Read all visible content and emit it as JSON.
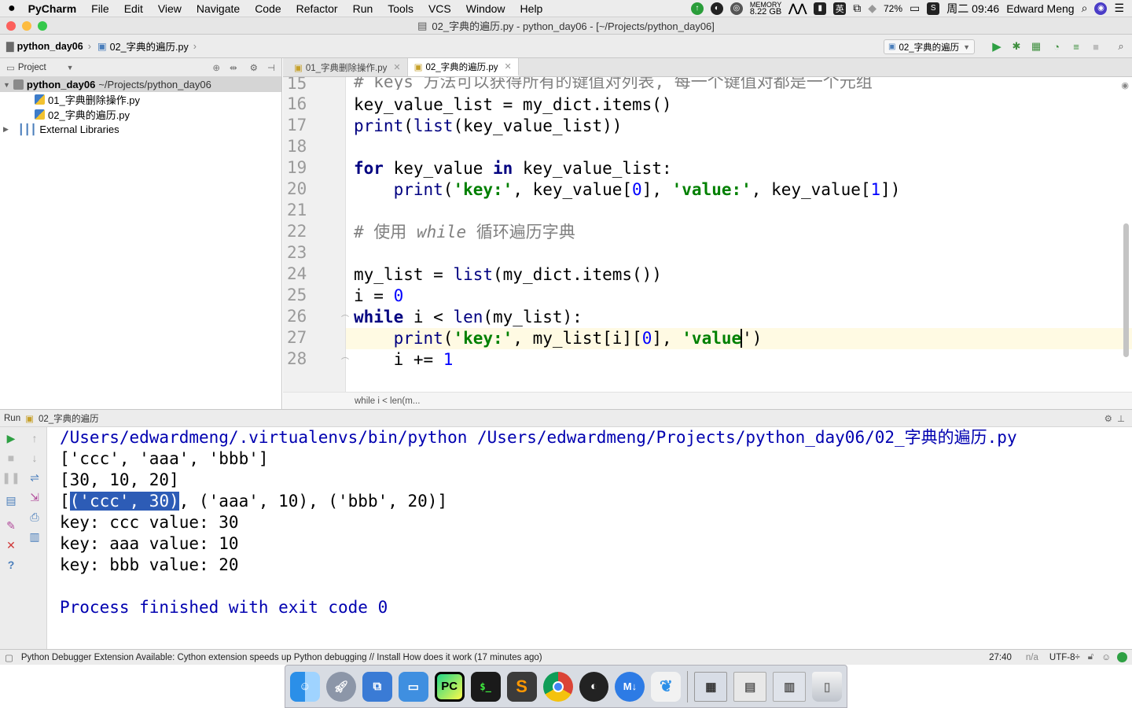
{
  "menubar": {
    "app": "PyCharm",
    "items": [
      "File",
      "Edit",
      "View",
      "Navigate",
      "Code",
      "Refactor",
      "Run",
      "Tools",
      "VCS",
      "Window",
      "Help"
    ],
    "memory_label": "MEMORY",
    "memory_value": "8.22 GB",
    "battery": "72%",
    "ime": "英",
    "clock": "周二 09:46",
    "user": "Edward Meng"
  },
  "window": {
    "title": "02_字典的遍历.py - python_day06 - [~/Projects/python_day06]"
  },
  "navbar": {
    "crumbs": [
      "python_day06",
      "02_字典的遍历.py"
    ],
    "run_config": "02_字典的遍历"
  },
  "project_panel": {
    "title": "Project",
    "root": "python_day06",
    "root_path": "~/Projects/python_day06",
    "files": [
      "01_字典删除操作.py",
      "02_字典的遍历.py"
    ],
    "libraries": "External Libraries"
  },
  "tabs": [
    {
      "label": "01_字典删除操作.py",
      "active": false
    },
    {
      "label": "02_字典的遍历.py",
      "active": true
    }
  ],
  "editor": {
    "line_numbers": [
      "15",
      "16",
      "17",
      "18",
      "19",
      "20",
      "21",
      "22",
      "23",
      "24",
      "25",
      "26",
      "27",
      "28"
    ],
    "line15_comment": "# keys 方法可以获得所有的键值对列表, 每一个键值对都是一个元组",
    "line16": {
      "a": "key_value_list = my_dict.items()"
    },
    "line17": {
      "fn": "print",
      "b": "(",
      "fn2": "list",
      "c": "(key_value_list))"
    },
    "line19": {
      "kw1": "for",
      "a": " key_value ",
      "kw2": "in",
      "b": " key_value_list:"
    },
    "line20": {
      "indent": "    ",
      "fn": "print",
      "b": "(",
      "s1": "'key:'",
      "c": ", key_value[",
      "n0": "0",
      "d": "], ",
      "s2": "'value:'",
      "e": ", key_value[",
      "n1": "1",
      "f": "])"
    },
    "line22_comment": "# 使用 ",
    "line22_kw": "while",
    "line22_rest": " 循环遍历字典",
    "line24": {
      "a": "my_list = ",
      "fn": "list",
      "b": "(my_dict.items())"
    },
    "line25": {
      "a": "i = ",
      "n": "0"
    },
    "line26": {
      "kw": "while",
      "a": " i < ",
      "fn": "len",
      "b": "(my_list):"
    },
    "line27": {
      "indent": "    ",
      "fn": "print",
      "b": "(",
      "s1": "'key:'",
      "c": ", my_list[i][",
      "n0": "0",
      "d": "], ",
      "s2": "'value",
      "e": "')"
    },
    "line28": {
      "indent": "    ",
      "a": "i += ",
      "n": "1"
    },
    "breadcrumb": "while i < len(m..."
  },
  "run_panel": {
    "label": "Run",
    "config": "02_字典的遍历",
    "output": {
      "cmd": "/Users/edwardmeng/.virtualenvs/bin/python /Users/edwardmeng/Projects/python_day06/02_字典的遍历.py",
      "l1": "['ccc', 'aaa', 'bbb']",
      "l2": "[30, 10, 20]",
      "l3_pre": "[",
      "l3_sel": "('ccc', 30)",
      "l3_post": ", ('aaa', 10), ('bbb', 20)]",
      "l4": "key: ccc value: 30",
      "l5": "key: aaa value: 10",
      "l6": "key: bbb value: 20",
      "finish": "Process finished with exit code 0"
    }
  },
  "statusbar": {
    "message": "Python Debugger Extension Available: Cython extension speeds up Python debugging // Install How does it work (17 minutes ago)",
    "position": "27:40",
    "na": "n/a",
    "encoding": "UTF-8÷"
  },
  "dock": {
    "apps": [
      "finder-icon",
      "launchpad-icon",
      "screens-icon",
      "keynote-icon",
      "pycharm-icon",
      "terminal-icon",
      "sublime-icon",
      "chrome-icon",
      "obs-icon",
      "markdown-icon",
      "monodraw-icon"
    ],
    "pycharm_label": "PC",
    "terminal_label": "$_",
    "markdown_label": "M↓"
  },
  "colors": {
    "accent": "#2d5cb6",
    "string": "#008000",
    "keyword": "#000080",
    "number": "#0000ff",
    "comment": "#808080"
  }
}
